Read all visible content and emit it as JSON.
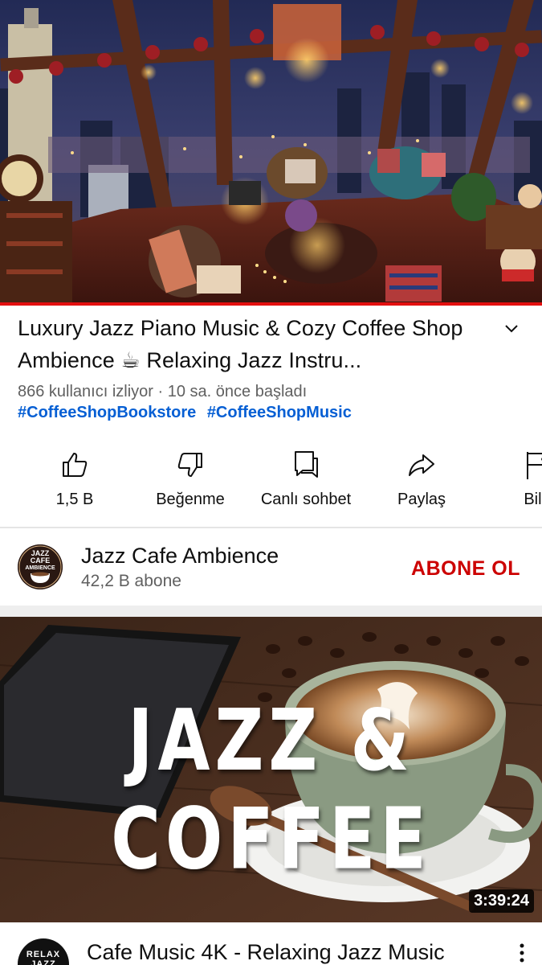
{
  "video": {
    "title": "Luxury Jazz Piano Music & Cozy Coffee Shop Ambience ☕ Relaxing Jazz Instru...",
    "meta": "866 kullanıcı izliyor · 10 sa. önce başladı",
    "hashtags": [
      "#CoffeeShopBookstore",
      "#CoffeeShopMusic"
    ],
    "progress_fraction": 1.0
  },
  "actions": [
    {
      "label": "1,5 B",
      "icon": "like-icon"
    },
    {
      "label": "Beğenme",
      "icon": "dislike-icon"
    },
    {
      "label": "Canlı sohbet",
      "icon": "live-chat-icon"
    },
    {
      "label": "Paylaş",
      "icon": "share-icon"
    },
    {
      "label": "Bild",
      "icon": "report-flag-icon"
    }
  ],
  "channel": {
    "name": "Jazz Cafe Ambience",
    "subscribers": "42,2 B abone",
    "subscribe_label": "ABONE OL",
    "avatar_text": [
      "JAZZ",
      "CAFE",
      "AMBIENCE"
    ],
    "accent_color": "#cc0000"
  },
  "next_video": {
    "thumbnail_text": "JAZZ & COFFEE",
    "duration": "3:39:24",
    "title": "Cafe Music 4K - Relaxing Jazz Music",
    "channel_avatar_text": "RELAX JAZZ"
  },
  "colors": {
    "progress": "#e30f0f",
    "hashtag": "#065fd4",
    "secondary_text": "#606060"
  }
}
